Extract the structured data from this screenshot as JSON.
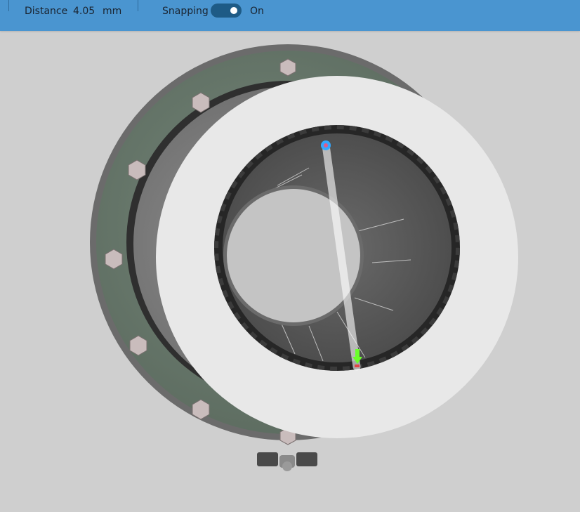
{
  "toolbar": {
    "distance_label": "Distance",
    "distance_value": "4.05",
    "distance_unit": "mm",
    "snapping_label": "Snapping",
    "snapping_state": "On",
    "snapping_on": true
  },
  "colors": {
    "toolbar_bg": "#4a95d0",
    "toggle_bg": "#1e5b86",
    "viewport_bg": "#cfcfcf",
    "flange": "#67786a",
    "rim": "#737373",
    "ring": "#e8e8e8",
    "bore": "#5b5b5b",
    "start_point": "#33a7ff",
    "end_marker": "#6aff2a"
  },
  "icons": {
    "start_point": "measure-start-point-icon",
    "end_point": "measure-end-arrow-icon"
  }
}
